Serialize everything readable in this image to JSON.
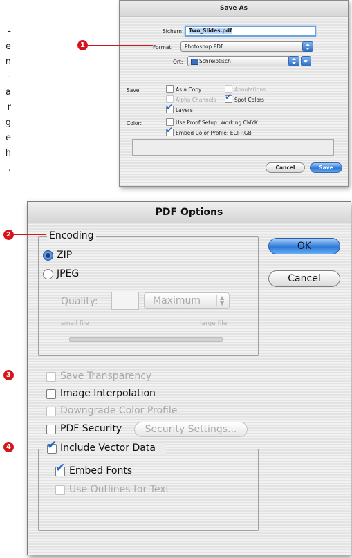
{
  "left_text": [
    "-",
    "e",
    "n",
    "-",
    "a",
    "r",
    "g",
    "e",
    "h",
    "."
  ],
  "save_as": {
    "title": "Save As",
    "sichern_label": "Sichern",
    "filename": "Two_Slides.pdf",
    "format_label": "Format:",
    "format_value": "Photoshop PDF",
    "ort_label": "Ort:",
    "ort_value": "Schreibtisch",
    "save_label": "Save:",
    "as_copy": "As a Copy",
    "annotations": "Annotations",
    "alpha_channels": "Alpha Channels",
    "spot_colors": "Spot Colors",
    "layers": "Layers",
    "color_label": "Color:",
    "use_proof": "Use Proof Setup:  Working CMYK",
    "embed_profile": "Embed Color Profile:  ECI-RGB",
    "cancel": "Cancel",
    "save": "Save"
  },
  "pdf_options": {
    "title": "PDF Options",
    "encoding": "Encoding",
    "zip": "ZIP",
    "jpeg": "JPEG",
    "quality_label": "Quality:",
    "quality_value": "Maximum",
    "small_file": "small file",
    "large_file": "large file",
    "ok": "OK",
    "cancel": "Cancel",
    "save_transparency": "Save Transparency",
    "image_interpolation": "Image Interpolation",
    "downgrade_profile": "Downgrade Color Profile",
    "pdf_security": "PDF Security",
    "security_settings": "Security Settings...",
    "include_vector": "Include Vector Data",
    "embed_fonts": "Embed Fonts",
    "use_outlines": "Use Outlines for Text"
  },
  "callouts": [
    "1",
    "2",
    "3",
    "4"
  ],
  "colors": {
    "callout": "#d8141b",
    "aqua_blue": "#2f7ad9",
    "check_blue": "#1d63c9"
  }
}
